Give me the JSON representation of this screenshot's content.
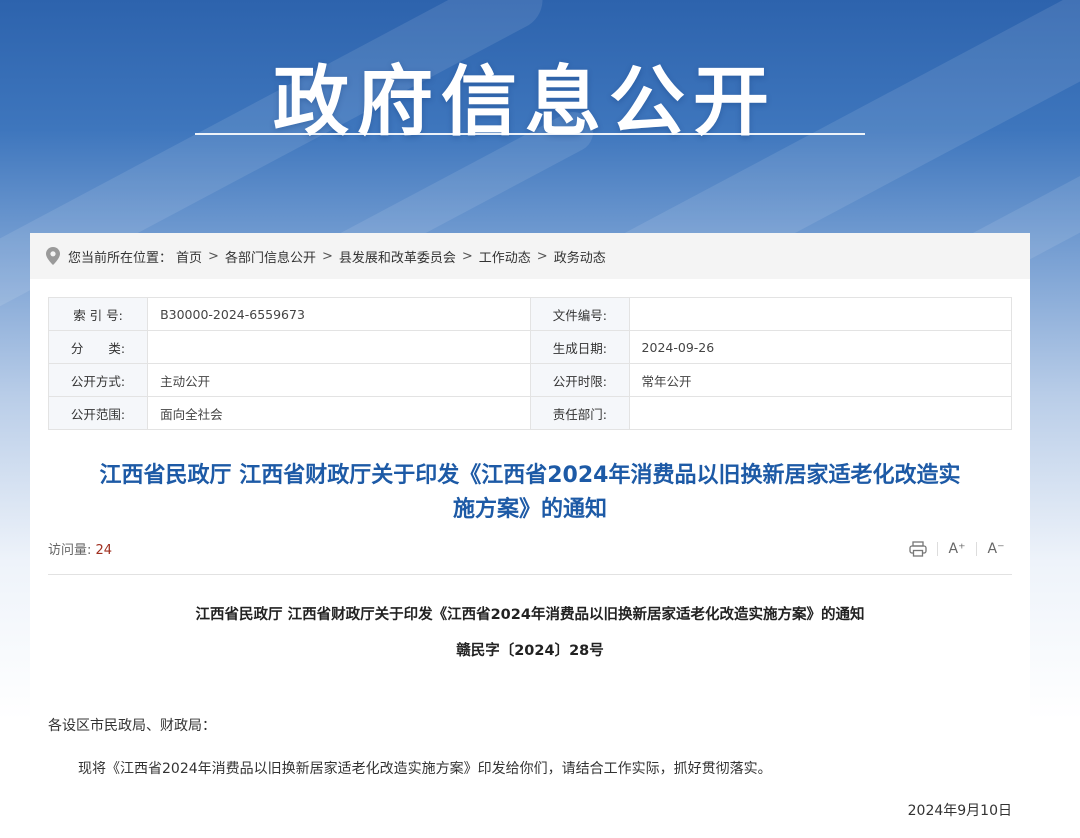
{
  "banner": {
    "title": "政府信息公开"
  },
  "breadcrumb": {
    "prefix": "您当前所在位置：",
    "items": [
      "首页",
      "各部门信息公开",
      "县发展和改革委员会",
      "工作动态",
      "政务动态"
    ],
    "separator": ">"
  },
  "meta": {
    "rows": [
      {
        "k1": "索 引 号:",
        "v1": "B30000-2024-6559673",
        "k2": "文件编号:",
        "v2": ""
      },
      {
        "k1": "分　　类:",
        "v1": "",
        "k2": "生成日期:",
        "v2": "2024-09-26"
      },
      {
        "k1": "公开方式:",
        "v1": "主动公开",
        "k2": "公开时限:",
        "v2": "常年公开"
      },
      {
        "k1": "公开范围:",
        "v1": "面向全社会",
        "k2": "责任部门:",
        "v2": ""
      }
    ]
  },
  "document": {
    "title_line1": "江西省民政厅 江西省财政厅关于印发《江西省2024年消费品以旧换新居家适老化改造实",
    "title_line2": "施方案》的通知",
    "views_label": "访问量:",
    "views_count": "24",
    "tools": {
      "print": "print-icon",
      "font_up": "A⁺",
      "font_down": "A⁻"
    },
    "sub_title": "江西省民政厅 江西省财政厅关于印发《江西省2024年消费品以旧换新居家适老化改造实施方案》的通知",
    "doc_number": "赣民字〔2024〕28号",
    "salutation": "各设区市民政局、财政局：",
    "body": "现将《江西省2024年消费品以旧换新居家适老化改造实施方案》印发给你们，请结合工作实际，抓好贯彻落实。",
    "date": "2024年9月10日"
  },
  "colors": {
    "accent": "#1d5aa6",
    "banner": "#2d63ad",
    "count": "#a03020"
  }
}
